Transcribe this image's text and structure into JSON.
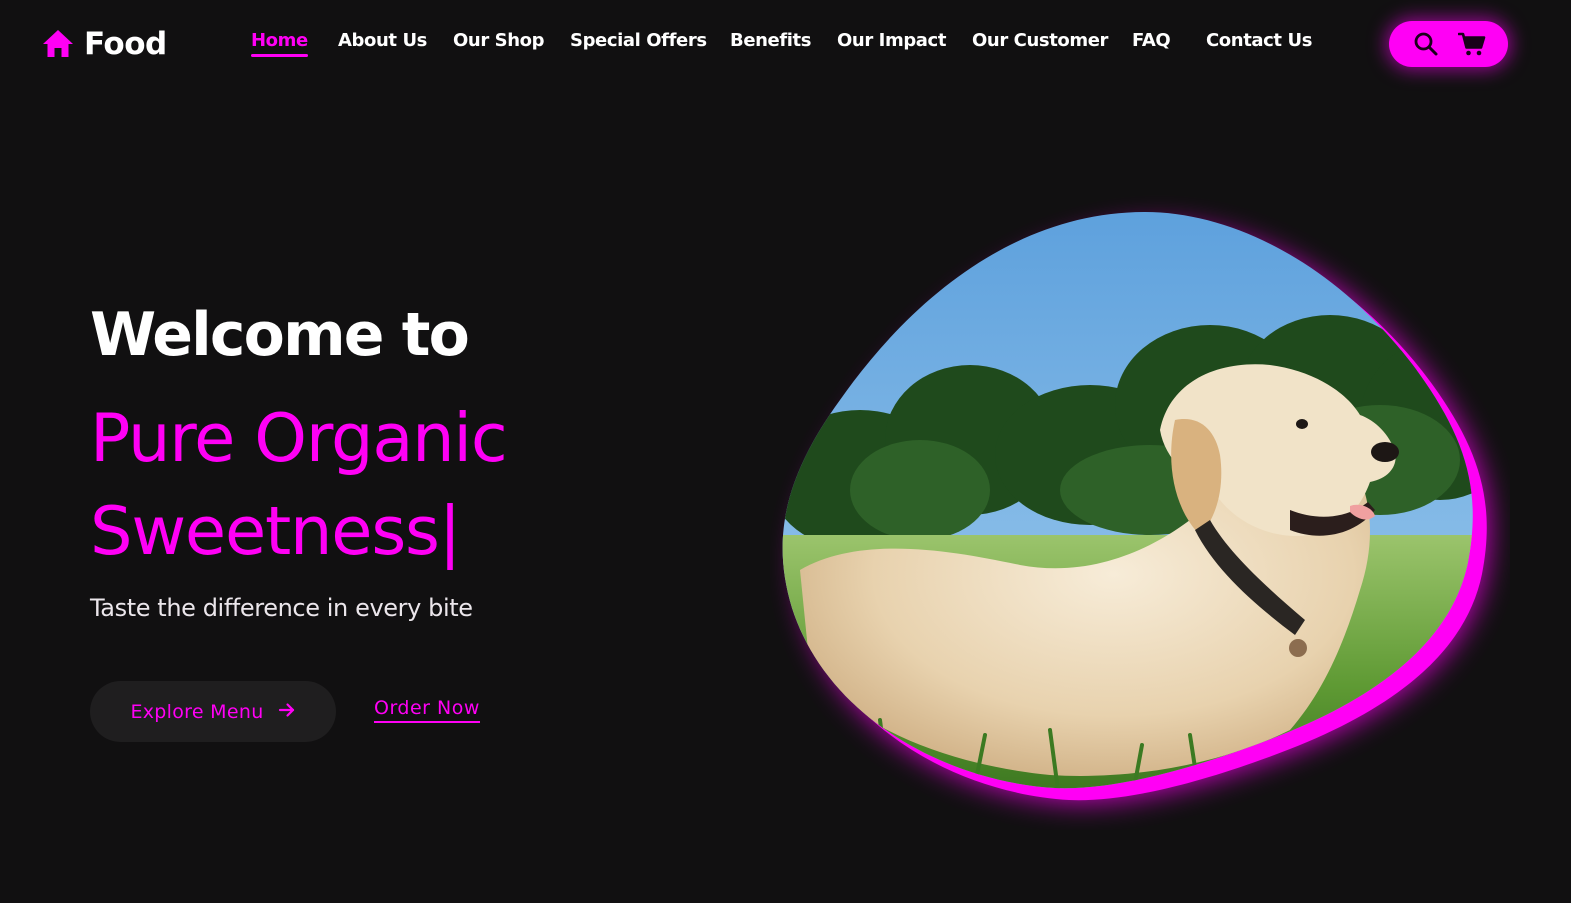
{
  "header": {
    "logo_text": "Food",
    "logo_icon": "home-icon",
    "nav": [
      {
        "label": "Home",
        "active": true
      },
      {
        "label": "About Us",
        "active": false
      },
      {
        "label": "Our Shop",
        "active": false
      },
      {
        "label": "Special Offers",
        "active": false
      },
      {
        "label": "Benefits",
        "active": false
      },
      {
        "label": "Our Impact",
        "active": false
      },
      {
        "label": "Our Customer",
        "active": false
      },
      {
        "label": "FAQ",
        "active": false
      },
      {
        "label": "Contact Us",
        "active": false
      }
    ],
    "actions": [
      {
        "icon": "search-icon"
      },
      {
        "icon": "cart-icon"
      }
    ]
  },
  "hero": {
    "welcome": "Welcome to",
    "title_line1": "Pure Organic",
    "title_line2": "Sweetness",
    "caret": "|",
    "subtitle": "Taste the difference in every bite",
    "explore_label": "Explore Menu",
    "explore_icon": "arrow-right-icon",
    "order_label": "Order Now",
    "image": "golden-retriever-lying-in-grass-photo"
  },
  "colors": {
    "background": "#111011",
    "accent": "#ff00f5",
    "button_dark": "#1f1e1f",
    "text": "#ffffff"
  }
}
